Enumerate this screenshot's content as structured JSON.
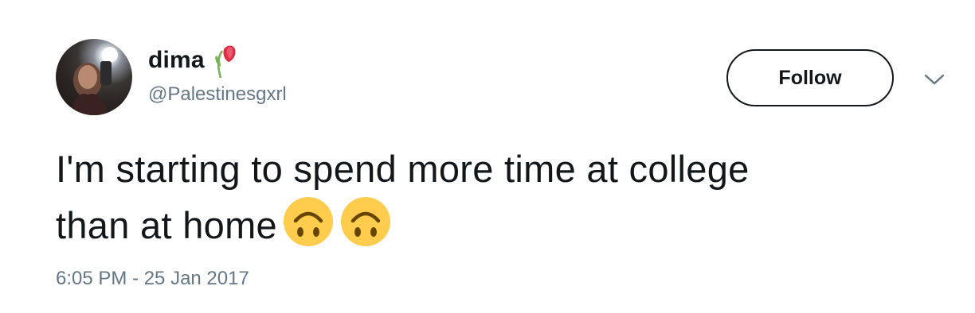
{
  "user": {
    "display_name": "dima",
    "handle": "@Palestinesgxrl",
    "name_emoji": "wilted-flower-icon"
  },
  "follow_button": {
    "label": "Follow"
  },
  "menu": {
    "icon": "chevron-down-icon"
  },
  "tweet": {
    "line1": "I'm starting to spend more time at college",
    "line2": "than at home",
    "emojis": [
      "upside-down-face-icon",
      "upside-down-face-icon"
    ],
    "timestamp": "6:05 PM - 25 Jan 2017"
  },
  "colors": {
    "text": "#14171a",
    "secondary": "#657786",
    "emoji_yellow": "#ffcc4d"
  }
}
